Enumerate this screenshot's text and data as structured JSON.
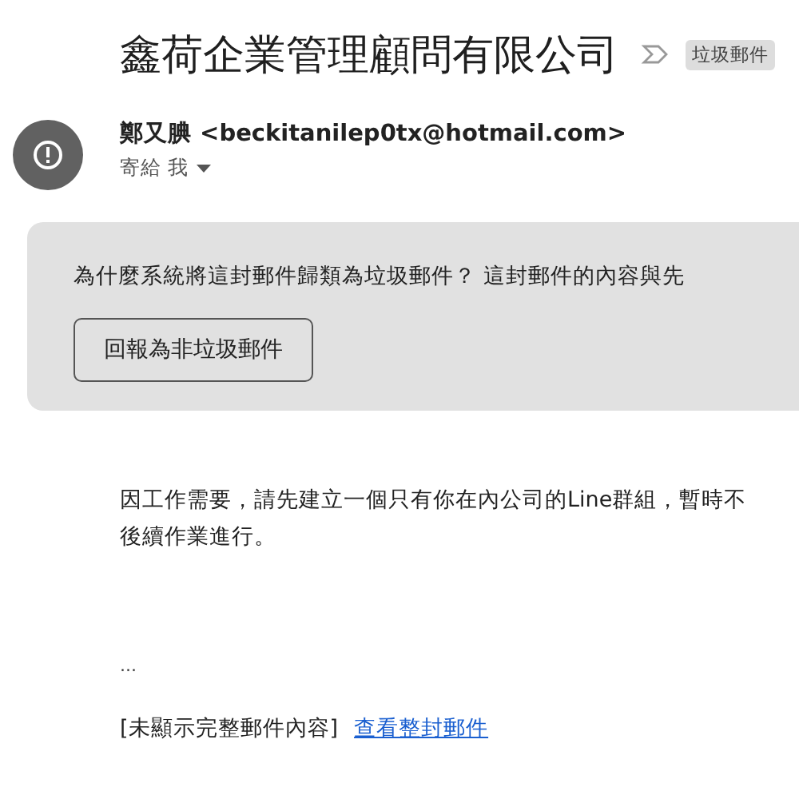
{
  "subject": "鑫荷企業管理顧問有限公司",
  "label": "垃圾郵件",
  "sender": {
    "name": "鄭又腆",
    "email": "<beckitanilep0tx@hotmail.com>",
    "recipient": "寄給 我"
  },
  "spam_notice": {
    "message": "為什麼系統將這封郵件歸類為垃圾郵件？ 這封郵件的內容與先",
    "button": "回報為非垃圾郵件"
  },
  "body": [
    "因工作需要，請先建立一個只有你在內公司的Line群組，暫時不",
    "後續作業進行。"
  ],
  "ellipsis": "...",
  "clipped": {
    "note": "[未顯示完整郵件內容]",
    "link": "查看整封郵件"
  }
}
